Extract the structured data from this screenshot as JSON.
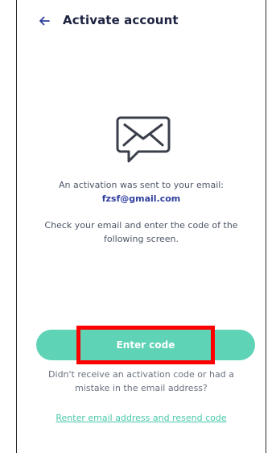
{
  "header": {
    "title": "Activate account",
    "back_icon": "arrow-left-icon"
  },
  "content": {
    "icon": "mail-chat-icon",
    "sent_message": "An activation was sent to your email:",
    "email": "fzsf@gmail.com",
    "instructions": "Check your email and enter the code of the following screen."
  },
  "actions": {
    "enter_code_label": "Enter code",
    "hint": "Didn't receive an activation code or had a mistake in the email address?",
    "resend_link": "Renter email address and resend code"
  },
  "colors": {
    "accent": "#5ed3b6",
    "title": "#1d2340",
    "email": "#2f3f9e",
    "link": "#49c7ab",
    "highlight": "#ff0000"
  }
}
